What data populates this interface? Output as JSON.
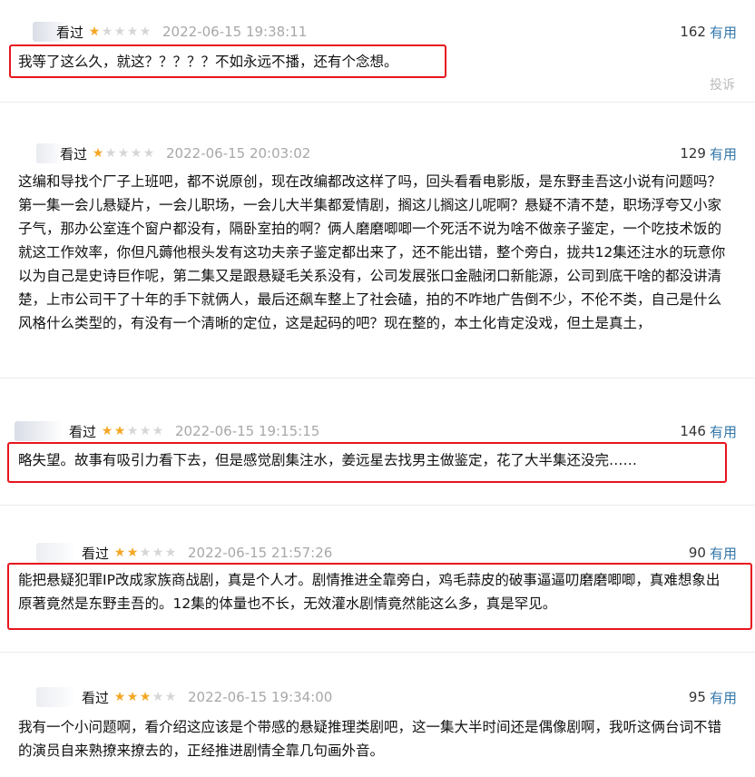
{
  "reviews": [
    {
      "status": "看过",
      "rating": 1,
      "time": "2022-06-15 19:38:11",
      "count": "162",
      "useful_label": "有用",
      "content": "我等了这么久，就这？？？？？不如永远不播，还有个念想。",
      "report_label": "投诉"
    },
    {
      "status": "看过",
      "rating": 1,
      "time": "2022-06-15 20:03:02",
      "count": "129",
      "useful_label": "有用",
      "content": "这编和导找个厂子上班吧，都不说原创，现在改编都改这样了吗，回头看看电影版，是东野圭吾这小说有问题吗？第一集一会儿悬疑片，一会儿职场，一会儿大半集都爱情剧，搁这儿搁这儿呢啊？悬疑不清不楚，职场浮夸又小家子气，那办公室连个窗户都没有，隔卧室拍的啊？俩人磨磨唧唧一个死活不说为啥不做亲子鉴定，一个吃技术饭的就这工作效率，你但凡薅他根头发有这功夫亲子鉴定都出来了，还不能出错，整个旁白，拢共12集还注水的玩意你以为自己是史诗巨作呢，第二集又是跟悬疑毛关系没有，公司发展张口金融闭口新能源，公司到底干啥的都没讲清楚，上市公司干了十年的手下就俩人，最后还飙车整上了社会磕，拍的不咋地广告倒不少，不伦不类，自己是什么风格什么类型的，有没有一个清晰的定位，这是起码的吧？现在整的，本土化肯定没戏，但土是真土，"
    },
    {
      "status": "看过",
      "rating": 2,
      "time": "2022-06-15 19:15:15",
      "count": "146",
      "useful_label": "有用",
      "content": "略失望。故事有吸引力看下去，但是感觉剧集注水，姜远星去找男主做鉴定，花了大半集还没完……"
    },
    {
      "status": "看过",
      "rating": 2,
      "time": "2022-06-15 21:57:26",
      "count": "90",
      "useful_label": "有用",
      "content": "能把悬疑犯罪IP改成家族商战剧，真是个人才。剧情推进全靠旁白，鸡毛蒜皮的破事逼逼叨磨磨唧唧，真难想象出原著竟然是东野圭吾的。12集的体量也不长，无效灌水剧情竟然能这么多，真是罕见。"
    },
    {
      "status": "看过",
      "rating": 3,
      "time": "2022-06-15 19:34:00",
      "count": "95",
      "useful_label": "有用",
      "content": "我有一个小问题啊，看介绍这应该是个带感的悬疑推理类剧吧，这一集大半时间还是偶像剧啊，我听这俩台词不错的演员自来熟撩来撩去的，正经推进剧情全靠几句画外音。"
    }
  ],
  "colors": {
    "highlight": "#e8141c",
    "star_on": "#f5a623",
    "star_off": "#d6d6d6",
    "link": "#3377aa"
  }
}
